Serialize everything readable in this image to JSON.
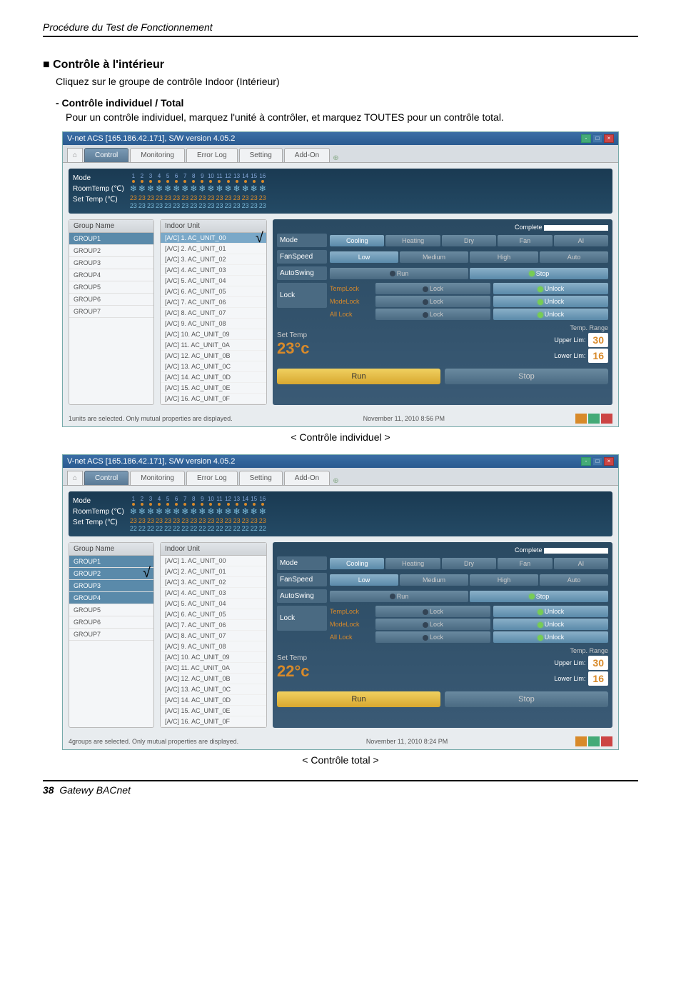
{
  "header": "Procédure du Test de Fonctionnement",
  "section": {
    "bullet": "■",
    "title": "Contrôle à l'intérieur",
    "desc": "Cliquez sur le groupe de contrôle Indoor (Intérieur)",
    "sub_title": "- Contrôle individuel / Total",
    "sub_desc": "Pour un contrôle individuel, marquez l'unité à contrôler, et marquez TOUTES pour un contrôle total."
  },
  "app": {
    "title": "V-net ACS [165.186.42.171],   S/W version 4.05.2",
    "tabs": {
      "home": "Home",
      "control": "Control",
      "monitoring": "Monitoring",
      "errorlog": "Error Log",
      "setting": "Setting",
      "addon": "Add-On"
    },
    "topband": {
      "mode": "Mode",
      "roomtemp": "RoomTemp (℃)",
      "settemp": "Set Temp   (℃)",
      "cols": [
        "1",
        "2",
        "3",
        "4",
        "5",
        "6",
        "7",
        "8",
        "9",
        "10",
        "11",
        "12",
        "13",
        "14",
        "15",
        "16"
      ],
      "v23": "23"
    },
    "group_header": "Group Name",
    "groups": [
      "GROUP1",
      "GROUP2",
      "GROUP3",
      "GROUP4",
      "GROUP5",
      "GROUP6",
      "GROUP7"
    ],
    "unit_header": "Indoor Unit",
    "units": [
      "[A/C] 1. AC_UNIT_00",
      "[A/C] 2. AC_UNIT_01",
      "[A/C] 3. AC_UNIT_02",
      "[A/C] 4. AC_UNIT_03",
      "[A/C] 5. AC_UNIT_04",
      "[A/C] 6. AC_UNIT_05",
      "[A/C] 7. AC_UNIT_06",
      "[A/C] 8. AC_UNIT_07",
      "[A/C] 9. AC_UNIT_08",
      "[A/C] 10. AC_UNIT_09",
      "[A/C] 11. AC_UNIT_0A",
      "[A/C] 12. AC_UNIT_0B",
      "[A/C] 13. AC_UNIT_0C",
      "[A/C] 14. AC_UNIT_0D",
      "[A/C] 15. AC_UNIT_0E",
      "[A/C] 16. AC_UNIT_0F"
    ],
    "ctrl": {
      "complete": "Complete",
      "mode": "Mode",
      "mode_opts": [
        "Cooling",
        "Heating",
        "Dry",
        "Fan",
        "AI"
      ],
      "fanspeed": "FanSpeed",
      "fan_opts": [
        "Low",
        "Medium",
        "High",
        "Auto"
      ],
      "autoswing": "AutoSwing",
      "swing_opts": [
        "Run",
        "Stop"
      ],
      "lock": "Lock",
      "locks": [
        {
          "name": "TempLock",
          "a": "Lock",
          "b": "Unlock"
        },
        {
          "name": "ModeLock",
          "a": "Lock",
          "b": "Unlock"
        },
        {
          "name": "All Lock",
          "a": "Lock",
          "b": "Unlock"
        }
      ],
      "settemp": "Set Temp",
      "temprange": "Temp. Range",
      "upper": "Upper Lim:",
      "upper_v": "30",
      "lower": "Lower Lim:",
      "lower_v": "16",
      "run": "Run",
      "stop": "Stop"
    }
  },
  "shot1": {
    "caption": "< Contrôle individuel >",
    "settemp_val": "23°c",
    "topband_settemp": "23",
    "status": "1units are selected. Only mutual properties are displayed.",
    "time": "November 11, 2010  8:56 PM"
  },
  "shot2": {
    "caption": "< Contrôle total >",
    "settemp_val": "22°c",
    "topband_settemp": "22",
    "status": "4groups are selected. Only mutual properties are displayed.",
    "time": "November 11, 2010  8:24 PM"
  },
  "footer": {
    "page": "38",
    "title": "Gatewy BACnet"
  }
}
